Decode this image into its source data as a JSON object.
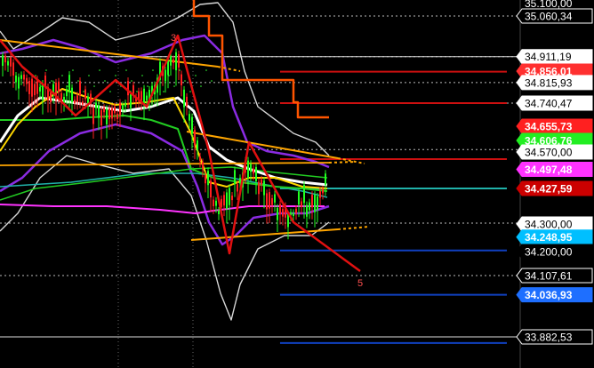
{
  "chart_data": {
    "type": "line",
    "title": "",
    "ylim": [
      33850,
      35100
    ],
    "grid": "dotted horizontal",
    "colors": {
      "background": "#000000",
      "price_down": "#ff2020",
      "price_up": "#20ff20",
      "bollinger_outer": "#d8d8d8",
      "bollinger_inner": "#8a2be2",
      "ma_white": "#ffffff",
      "ma_yellow": "#ffd700",
      "ma_green": "#22cc22",
      "ma_magenta": "#ff33ff",
      "ma_teal": "#20b2aa",
      "trend_orange": "#ffa500",
      "zigzag_red": "#e01010",
      "stepped_orange": "#ff5500"
    },
    "zigzag_labels": [
      "3",
      "5"
    ],
    "price_axis_top": "35.100,00",
    "price_labels": [
      {
        "value": 35060.34,
        "text": "35.060,34",
        "bg": "#000000",
        "fg": "#ffffff",
        "border": "#ffffff"
      },
      {
        "value": 34911.19,
        "text": "34.911,19",
        "bg": "#ffffff",
        "fg": "#000000",
        "border": "#ffffff"
      },
      {
        "value": 34856.01,
        "text": "34.856,01",
        "bg": "#ff3030",
        "fg": "#ffffff",
        "border": "#ff3030"
      },
      {
        "value": 34815.93,
        "text": "34.815,93",
        "bg": "#ffffff",
        "fg": "#000000",
        "border": "#ffffff"
      },
      {
        "value": 34740.47,
        "text": "34.740,47",
        "bg": "#ffffff",
        "fg": "#000000",
        "border": "#ffffff"
      },
      {
        "value": 34655.73,
        "text": "34.655,73",
        "bg": "#ff2020",
        "fg": "#ffffff",
        "border": "#ff2020"
      },
      {
        "value": 34606.76,
        "text": "34.606,76",
        "bg": "#22ee22",
        "fg": "#ffffff",
        "border": "#22ee22"
      },
      {
        "value": 34570.0,
        "text": "34.570,00",
        "bg": "#ffffff",
        "fg": "#000000",
        "border": "#ffffff"
      },
      {
        "value": 34497.48,
        "text": "34.497,48",
        "bg": "#ff33ff",
        "fg": "#ffffff",
        "border": "#ff33ff"
      },
      {
        "value": 34427.59,
        "text": "34.427,59",
        "bg": "#cc0000",
        "fg": "#ffffff",
        "border": "#cc0000"
      },
      {
        "value": 34300.0,
        "text": "34.300,00",
        "bg": "#ffffff",
        "fg": "#000000",
        "border": "#ffffff"
      },
      {
        "value": 34248.95,
        "text": "34.248,95",
        "bg": "#00bfff",
        "fg": "#ffffff",
        "border": "#00bfff"
      },
      {
        "value": 34200.0,
        "text": "34.200,00",
        "bg": "#000000",
        "fg": "#ffffff",
        "border": "#000000"
      },
      {
        "value": 34107.61,
        "text": "34.107,61",
        "bg": "#000000",
        "fg": "#ffffff",
        "border": "#ffffff"
      },
      {
        "value": 34036.93,
        "text": "34.036,93",
        "bg": "#1e6fff",
        "fg": "#ffffff",
        "border": "#1e6fff"
      },
      {
        "value": 33882.53,
        "text": "33.882,53",
        "bg": "#000000",
        "fg": "#ffffff",
        "border": "#ffffff"
      }
    ],
    "gridlines_dotted": [
      35060.34,
      34911.19,
      34815.93,
      34740.47,
      34570.0,
      34300.0,
      34107.61
    ],
    "gridlines_solid_white": [
      34911.19,
      33882.53
    ],
    "levels": [
      {
        "value": 34856.01,
        "color": "#cc1010",
        "from": 0.47
      },
      {
        "value": 34740.47,
        "color": "#cc1010",
        "from": 0.47
      },
      {
        "value": 34535.0,
        "color": "#cc1010",
        "from": 0.47
      },
      {
        "value": 34427.59,
        "color": "#20b2aa",
        "from": 0.47
      },
      {
        "value": 34200.0,
        "color": "#1040c0",
        "from": 0.47
      },
      {
        "value": 34036.93,
        "color": "#1040c0",
        "from": 0.47
      },
      {
        "value": 33860.0,
        "color": "#1040c0",
        "from": 0.47
      }
    ]
  }
}
